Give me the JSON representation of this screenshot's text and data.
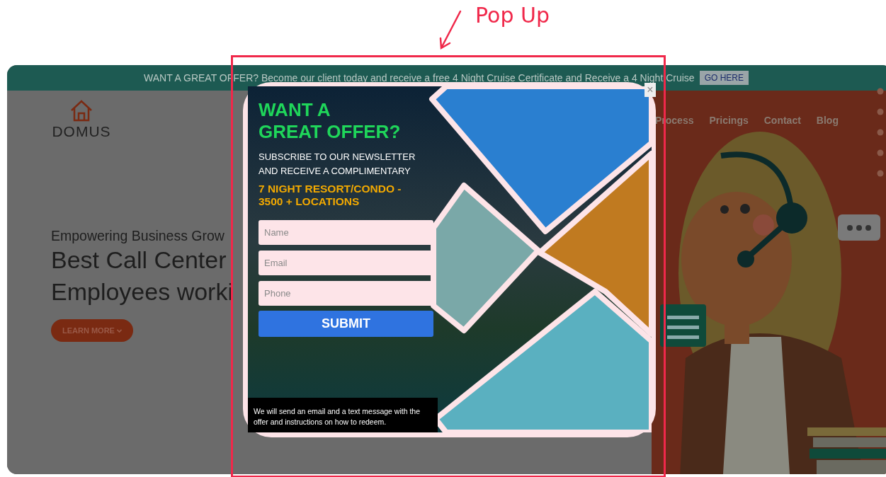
{
  "annotation": {
    "label": "Pop Up"
  },
  "banner": {
    "text": "WANT A GREAT OFFER? Become our client today and receive a free 4 Night Cruise Certificate and Receive a 4 Night Cruise",
    "button": "GO HERE"
  },
  "site": {
    "logo": "DOMUS",
    "nav": [
      "Process",
      "Pricings",
      "Contact",
      "Blog"
    ],
    "hero": {
      "eyebrow": "Empowering Business Grow",
      "headline": [
        "Best Call Center",
        "Employees worki"
      ],
      "button": "LEARN MORE"
    }
  },
  "popup": {
    "close": "×",
    "heading": [
      "WANT A",
      "GREAT OFFER?"
    ],
    "subheading": [
      "SUBSCRIBE TO OUR NEWSLETTER",
      "AND RECEIVE A COMPLIMENTARY"
    ],
    "highlight": [
      "7 NIGHT RESORT/CONDO -",
      "3500 + LOCATIONS"
    ],
    "fields": [
      {
        "placeholder": "Name"
      },
      {
        "placeholder": "Email"
      },
      {
        "placeholder": "Phone"
      }
    ],
    "submit": "SUBMIT",
    "footnote": "We will send an email and a text message with the offer and instructions on how to redeem."
  }
}
